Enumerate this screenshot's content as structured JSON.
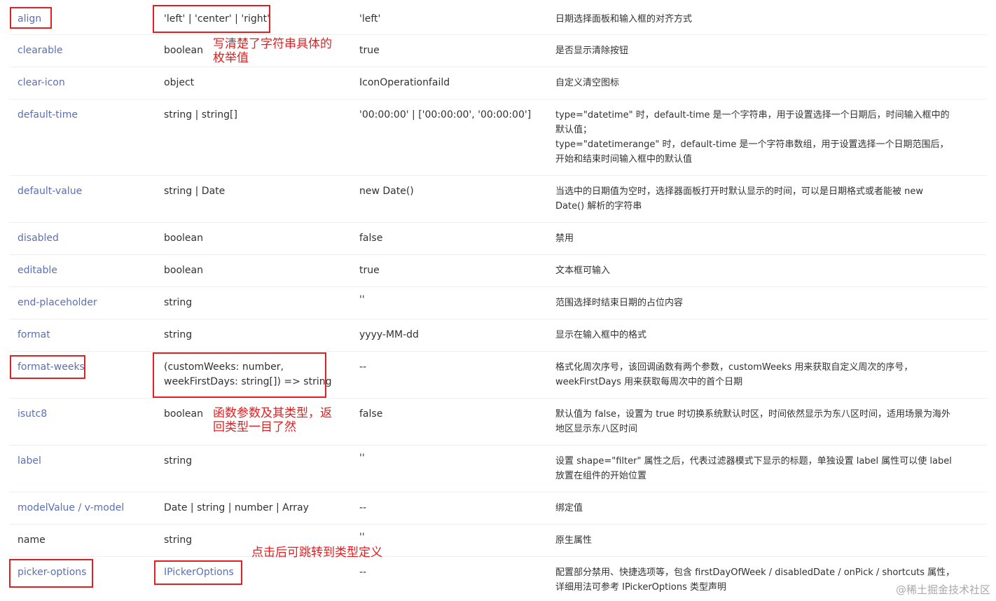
{
  "rows": [
    {
      "name": "align",
      "type": "'left' | 'center' | 'right'",
      "default": "'left'",
      "desc": "日期选择面板和输入框的对齐方式"
    },
    {
      "name": "clearable",
      "type": "boolean",
      "default": "true",
      "desc": "是否显示清除按钮"
    },
    {
      "name": "clear-icon",
      "type": "object",
      "default": "IconOperationfaild",
      "desc": "自定义清空图标"
    },
    {
      "name": "default-time",
      "type": "string | string[]",
      "default": "'00:00:00' | ['00:00:00', '00:00:00']",
      "desc1": "type=\"datetime\" 时，default-time 是一个字符串，用于设置选择一个日期后，时间输入框中的",
      "desc2": "默认值；",
      "desc3": "type=\"datetimerange\" 时，default-time 是一个字符串数组，用于设置选择一个日期范围后，",
      "desc4": "开始和结束时间输入框中的默认值"
    },
    {
      "name": "default-value",
      "type": "string | Date",
      "default": "new Date()",
      "desc1": "当选中的日期值为空时，选择器面板打开时默认显示的时间，可以是日期格式或者能被 new",
      "desc2": "Date() 解析的字符串"
    },
    {
      "name": "disabled",
      "type": "boolean",
      "default": "false",
      "desc": "禁用"
    },
    {
      "name": "editable",
      "type": "boolean",
      "default": "true",
      "desc": "文本框可输入"
    },
    {
      "name": "end-placeholder",
      "type": "string",
      "default": "''",
      "desc": "范围选择时结束日期的占位内容"
    },
    {
      "name": "format",
      "type": "string",
      "default": "yyyy-MM-dd",
      "desc": "显示在输入框中的格式"
    },
    {
      "name": "format-weeks",
      "type1": "(customWeeks: number,",
      "type2": "weekFirstDays: string[]) => string",
      "default": "--",
      "desc1": "格式化周次序号，该回调函数有两个参数，customWeeks 用来获取自定义周次的序号，",
      "desc2": "weekFirstDays 用来获取每周次中的首个日期"
    },
    {
      "name": "isutc8",
      "type": "boolean",
      "default": "false",
      "desc1": "默认值为 false，设置为 true 时切换系统默认时区，时间依然显示为东八区时间，适用场景为海外",
      "desc2": "地区显示东八区时间"
    },
    {
      "name": "label",
      "type": "string",
      "default": "''",
      "desc1": "设置 shape=\"filter\" 属性之后，代表过滤器模式下显示的标题，单独设置 label 属性可以使 label",
      "desc2": "放置在组件的开始位置"
    },
    {
      "name": "modelValue / v-model",
      "type": "Date | string | number | Array",
      "default": "--",
      "desc": "绑定值"
    },
    {
      "name": "name",
      "type": "string",
      "default": "''",
      "desc": "原生属性"
    },
    {
      "name": "picker-options",
      "type": "IPickerOptions",
      "default": "--",
      "desc1": "配置部分禁用、快捷选项等，包含 firstDayOfWeek / disabledDate / onPick / shortcuts 属性，",
      "desc2": "详细用法可参考 IPickerOptions 类型声明"
    }
  ],
  "notes": {
    "enum": "写清楚了字符串具体的\n枚举值",
    "func": "函数参数及其类型，返\n回类型一目了然",
    "jump": "点击后可跳转到类型定义"
  },
  "watermark": "@稀土掘金技术社区"
}
